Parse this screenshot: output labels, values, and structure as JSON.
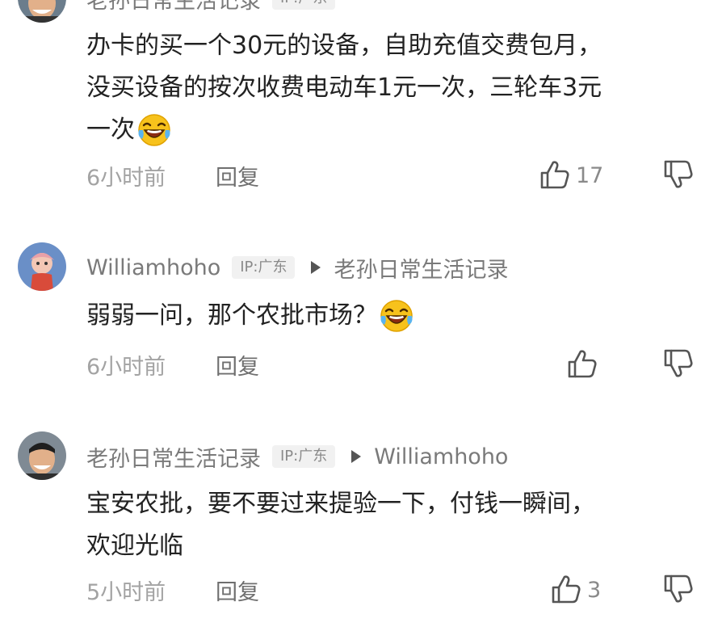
{
  "comments": [
    {
      "author": "老孙日常生活记录",
      "ip": "IP:广东",
      "reply_to": "",
      "lines": [
        "办卡的买一个30元的设备，自助充值交费包月，",
        "没买设备的按次收费电动车1元一次，三轮车3元",
        "一次"
      ],
      "emoji": "laughing-tears-emoji",
      "time": "6小时前",
      "reply_label": "回复",
      "likes": "17"
    },
    {
      "author": "Williamhoho",
      "ip": "IP:广东",
      "reply_to": "老孙日常生活记录",
      "lines": [
        "弱弱一问，那个农批市场？"
      ],
      "emoji": "laughing-tears-emoji",
      "time": "6小时前",
      "reply_label": "回复",
      "likes": ""
    },
    {
      "author": "老孙日常生活记录",
      "ip": "IP:广东",
      "reply_to": "Williamhoho",
      "lines": [
        "宝安农批，要不要过来提验一下，付钱一瞬间，",
        "欢迎光临"
      ],
      "emoji": "",
      "time": "5小时前",
      "reply_label": "回复",
      "likes": "3"
    }
  ],
  "colors": {
    "text": "#222222",
    "meta": "#7a7a7a",
    "time": "#a3a3a3",
    "badge_bg": "#f1f1f1"
  }
}
